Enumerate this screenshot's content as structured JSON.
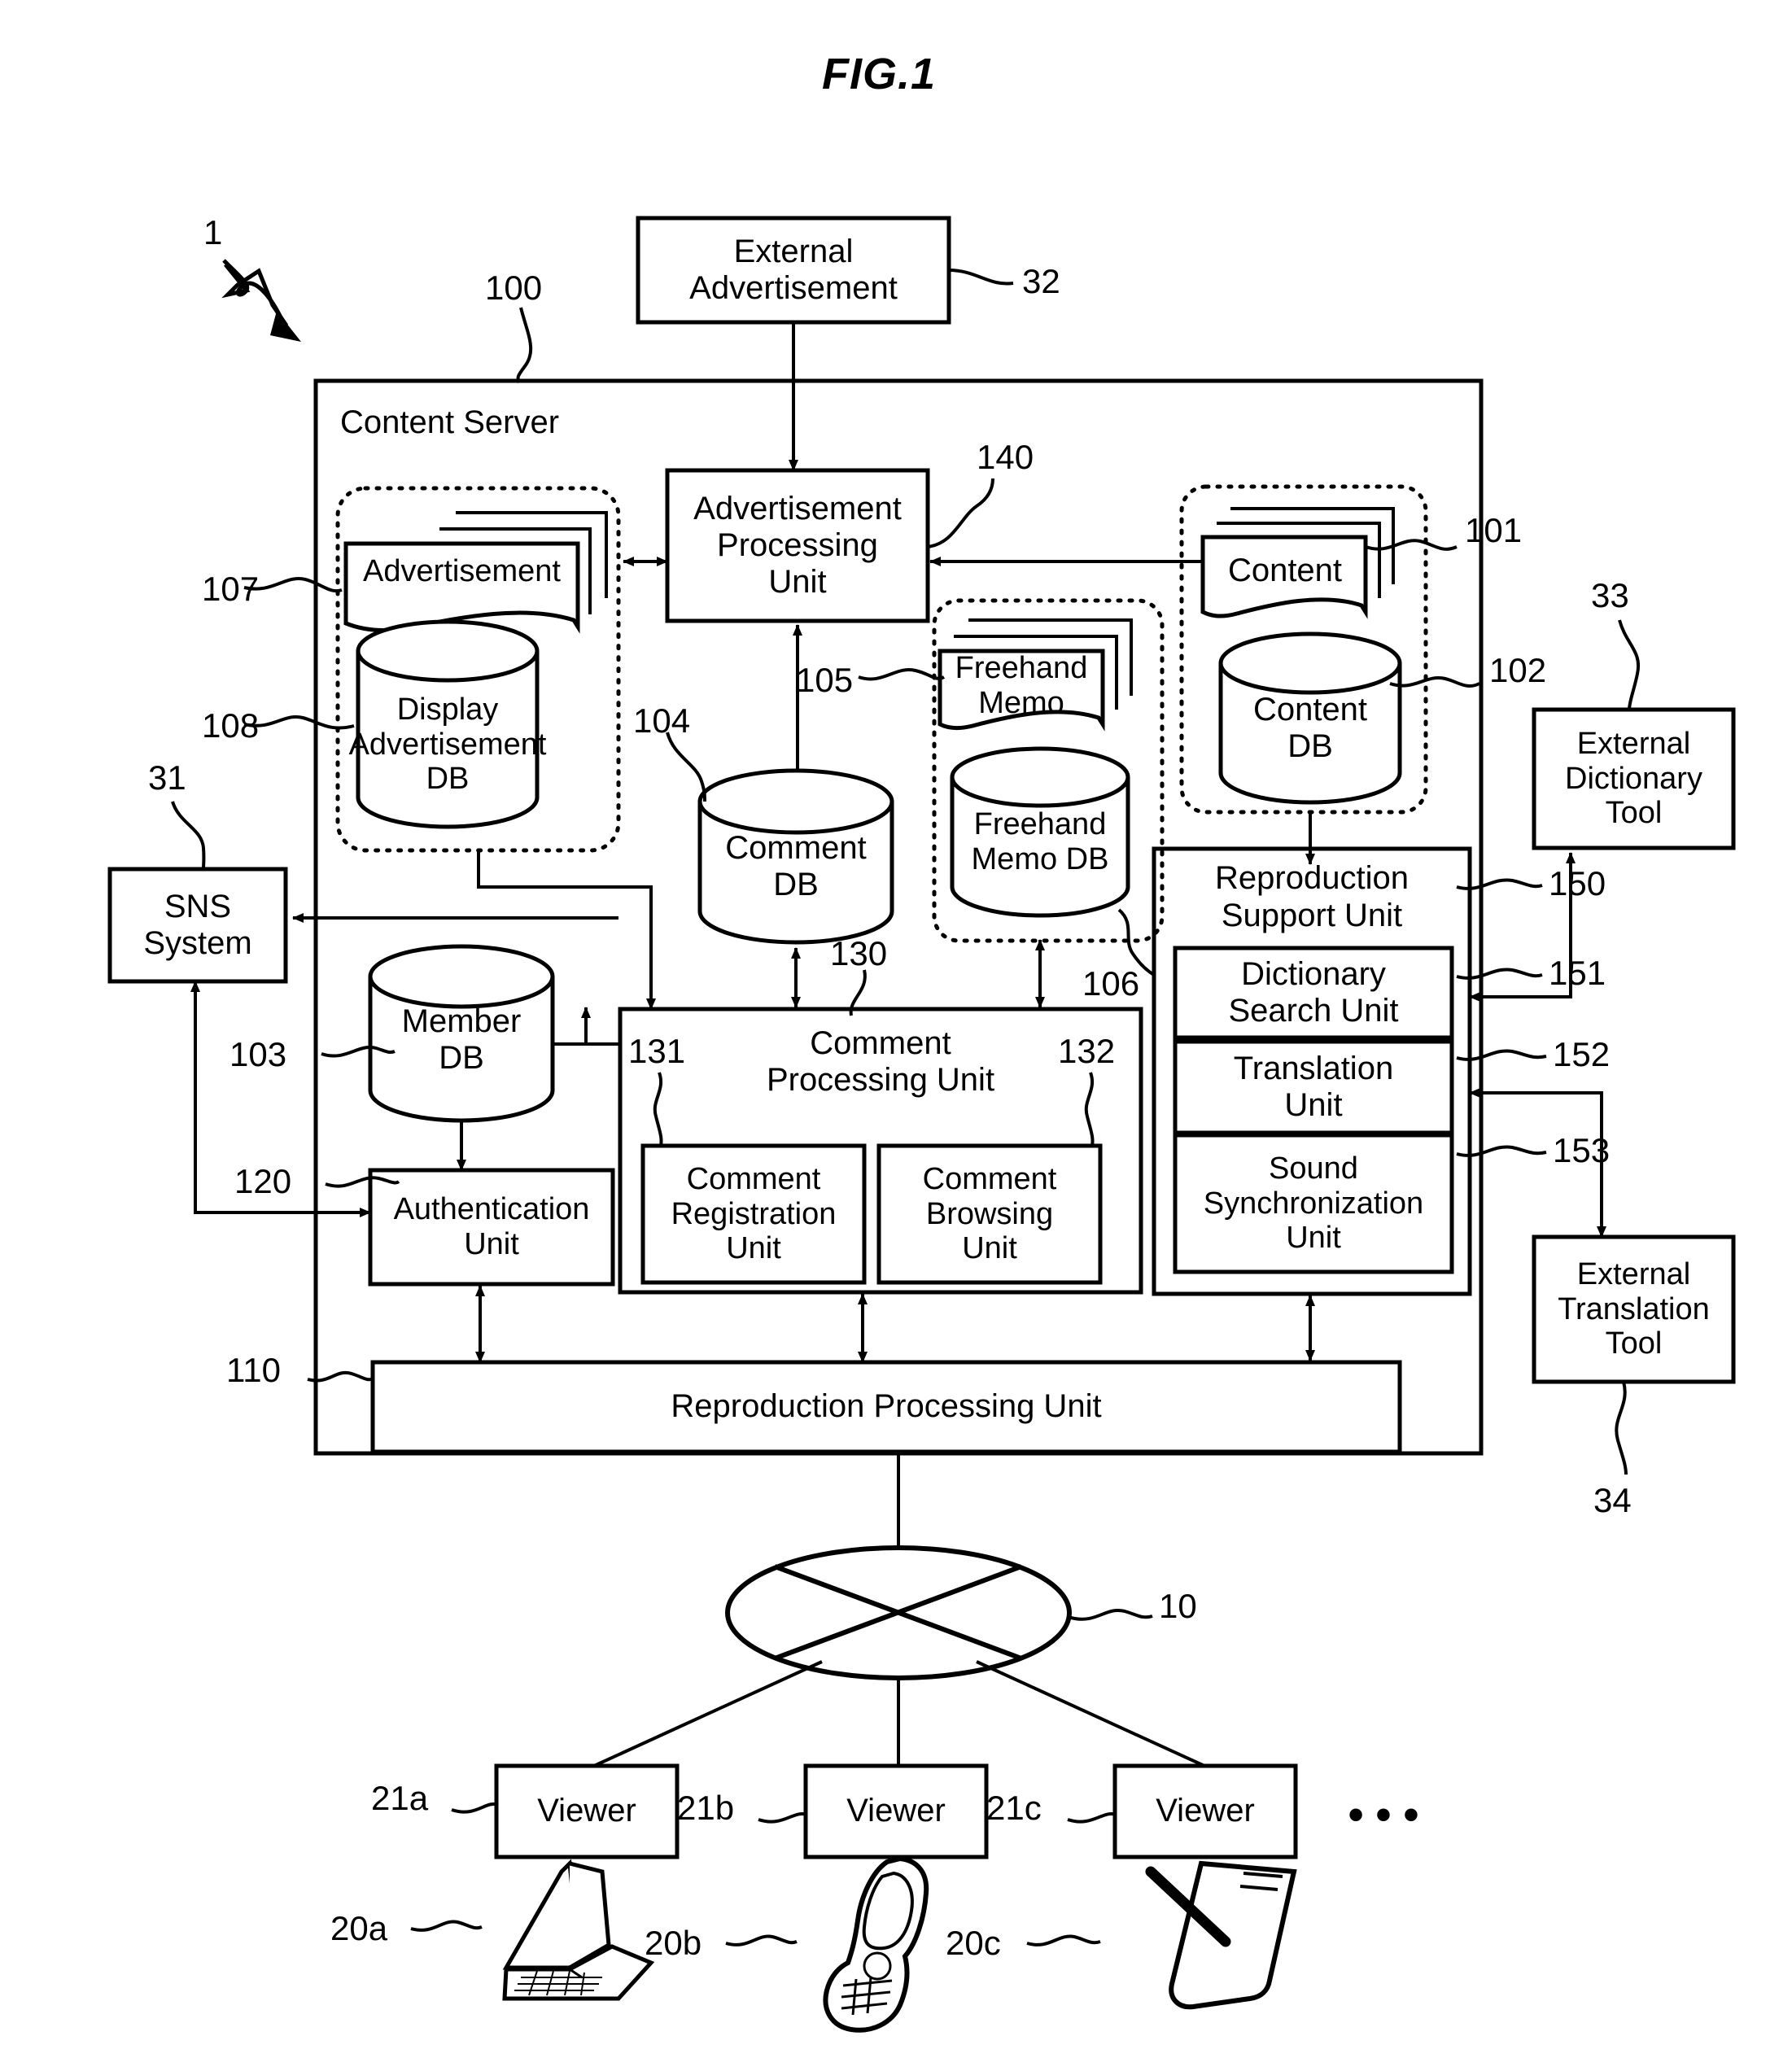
{
  "figure": {
    "title": "FIG.1",
    "system_ref": "1"
  },
  "blocks": {
    "external_advertisement": {
      "label": "External\nAdvertisement",
      "ref": "32"
    },
    "content_server": {
      "label": "Content Server",
      "ref": "100"
    },
    "advertisement_processing_unit": {
      "label": "Advertisement\nProcessing\nUnit",
      "ref": "140"
    },
    "advertisement": {
      "label": "Advertisement",
      "ref": "107"
    },
    "display_advertisement_db": {
      "label": "Display\nAdvertisement\nDB",
      "ref": "108"
    },
    "comment_db": {
      "label": "Comment\nDB",
      "ref": "104"
    },
    "freehand_memo": {
      "label": "Freehand\nMemo",
      "ref": "105"
    },
    "freehand_memo_db": {
      "label": "Freehand\nMemo DB",
      "ref": "106"
    },
    "content": {
      "label": "Content",
      "ref": "101"
    },
    "content_db": {
      "label": "Content\nDB",
      "ref": "102"
    },
    "external_dictionary_tool": {
      "label": "External\nDictionary\nTool",
      "ref": "33"
    },
    "reproduction_support_unit": {
      "label": "Reproduction\nSupport Unit",
      "ref": "150"
    },
    "dictionary_search_unit": {
      "label": "Dictionary\nSearch Unit",
      "ref": "151"
    },
    "translation_unit": {
      "label": "Translation\nUnit",
      "ref": "152"
    },
    "sound_synchronization_unit": {
      "label": "Sound\nSynchronization\nUnit",
      "ref": "153"
    },
    "external_translation_tool": {
      "label": "External\nTranslation\nTool",
      "ref": "34"
    },
    "sns_system": {
      "label": "SNS\nSystem",
      "ref": "31"
    },
    "member_db": {
      "label": "Member\nDB",
      "ref": "103"
    },
    "authentication_unit": {
      "label": "Authentication\nUnit",
      "ref": "120"
    },
    "comment_processing_unit": {
      "label": "Comment\nProcessing Unit",
      "ref": "130"
    },
    "comment_registration_unit": {
      "label": "Comment\nRegistration\nUnit",
      "ref": "131"
    },
    "comment_browsing_unit": {
      "label": "Comment\nBrowsing\nUnit",
      "ref": "132"
    },
    "reproduction_processing_unit": {
      "label": "Reproduction Processing Unit",
      "ref": "110"
    },
    "network": {
      "label": "",
      "ref": "10"
    },
    "viewer_a": {
      "label": "Viewer",
      "ref": "21a"
    },
    "viewer_b": {
      "label": "Viewer",
      "ref": "21b"
    },
    "viewer_c": {
      "label": "Viewer",
      "ref": "21c"
    },
    "device_laptop": {
      "label": "",
      "ref": "20a"
    },
    "device_mobile_phone": {
      "label": "",
      "ref": "20b"
    },
    "device_tablet_stylus": {
      "label": "",
      "ref": "20c"
    },
    "ellipsis": {
      "label": "• • •"
    }
  },
  "colors": {
    "line": "#000000",
    "background": "#ffffff"
  }
}
